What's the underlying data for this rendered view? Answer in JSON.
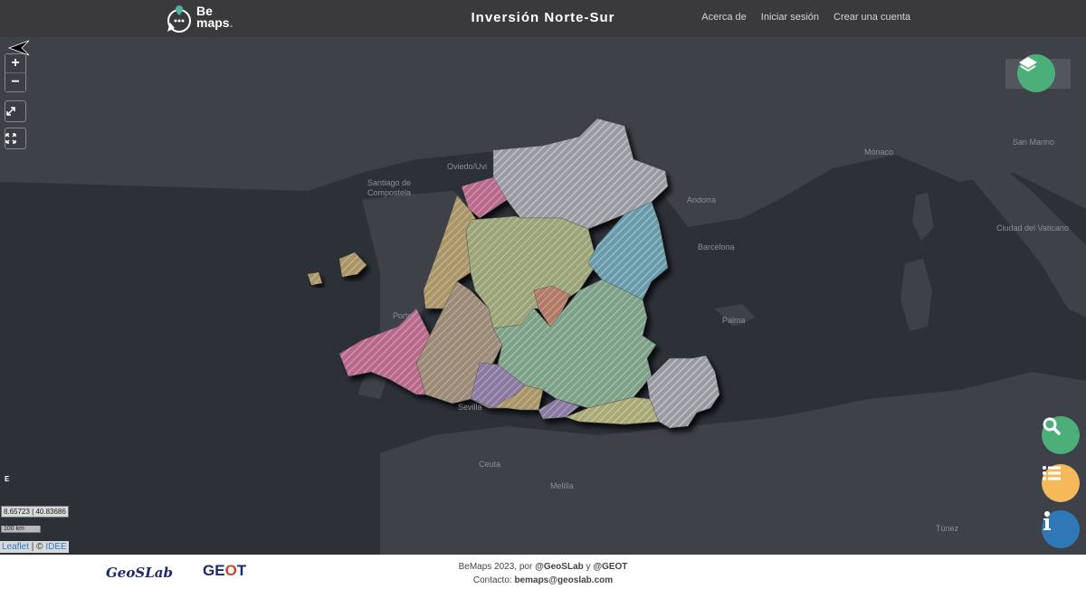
{
  "header": {
    "logo_line1": "Be",
    "logo_line2": "maps",
    "title": "Inversión Norte-Sur",
    "nav": [
      "Acerca de",
      "Iniciar sesión",
      "Crear una cuenta"
    ]
  },
  "map": {
    "zoom_in": "+",
    "zoom_out": "−",
    "coords": "8.65723 | 40.83686",
    "scale": "100 km",
    "north_label": "E",
    "attribution": {
      "leaflet": "Leaflet",
      "sep": " | © ",
      "idee": "IDEE"
    },
    "places": [
      "Oviedo/Uvi",
      "Santiago de",
      "Compostela",
      "Andorra",
      "Mónaco",
      "San Marino",
      "Barcelona",
      "Ciudad del Vaticano",
      "Palma",
      "Porto",
      "Sevilla",
      "Ceuta",
      "Melilla",
      "Túnez"
    ],
    "colors": {
      "sea": "#2c3138",
      "land": "#3e4147",
      "search": "#4caf7a",
      "list": "#f5b95c",
      "info": "#2e78b5",
      "layers": "#4caf7a"
    }
  },
  "footer": {
    "geoslab": "GeoSLab",
    "geot_pre": "GE",
    "geot_o": "O",
    "geot_post": "T",
    "line1_pre": "BeMaps 2023, por ",
    "line1_a": "@GeoSLab",
    "line1_mid": " y ",
    "line1_b": "@GEOT",
    "line2_pre": "Contacto: ",
    "line2_email": "bemaps@geoslab.com"
  }
}
